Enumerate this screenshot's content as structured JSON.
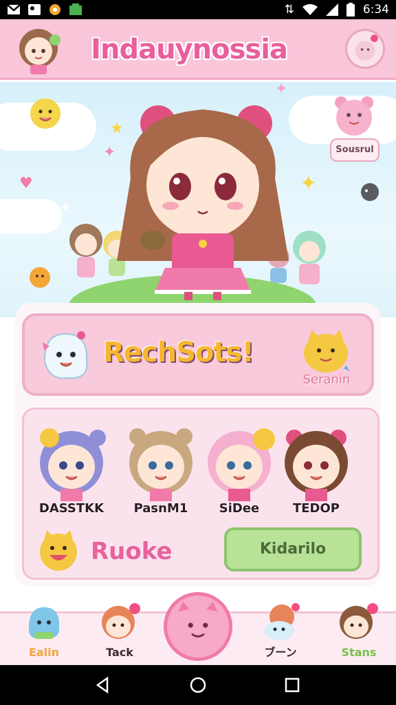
{
  "status_bar": {
    "time": "6:34"
  },
  "header": {
    "title": "Indauynossia"
  },
  "scene": {
    "mini_sticker_label": "Sousrul"
  },
  "banner": {
    "title": "RechSots!",
    "subtitle": "Seranin"
  },
  "characters": [
    {
      "name": "DASSTKK"
    },
    {
      "name": "PasnM1"
    },
    {
      "name": "SiDee"
    },
    {
      "name": "TEDOP"
    }
  ],
  "rookie": {
    "label": "Ruoke"
  },
  "action_button": {
    "label": "Kidarilo"
  },
  "nav": [
    {
      "label": "Ealin",
      "color": "#f3a536"
    },
    {
      "label": "Tack",
      "color": "#3c2a2a"
    },
    {
      "label": ""
    },
    {
      "label": "ブーン",
      "color": "#3c2a2a"
    },
    {
      "label": "Stans",
      "color": "#7bbf4a"
    }
  ]
}
